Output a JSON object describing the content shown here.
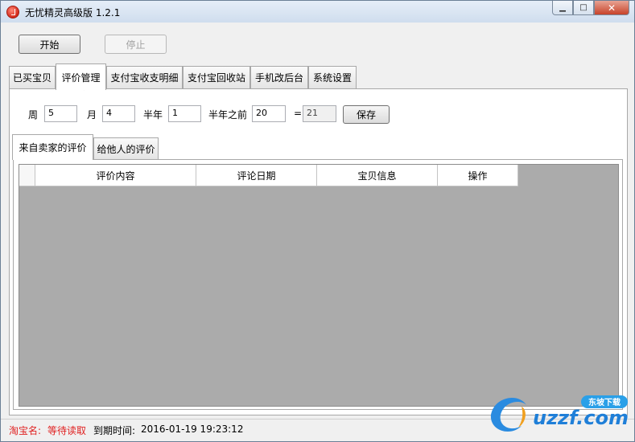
{
  "window": {
    "title": "无忧精灵高级版 1.2.1"
  },
  "window_controls": {
    "minimize": "▁",
    "maximize": "□",
    "close": "✕"
  },
  "toolbar": {
    "start_label": "开始",
    "stop_label": "停止"
  },
  "tabs": [
    {
      "label": "已买宝贝"
    },
    {
      "label": "评价管理"
    },
    {
      "label": "支付宝收支明细"
    },
    {
      "label": "支付宝回收站"
    },
    {
      "label": "手机改后台"
    },
    {
      "label": "系统设置"
    }
  ],
  "settings": {
    "week_label": "周",
    "week_value": "5",
    "month_label": "月",
    "month_value": "4",
    "halfyear_label": "半年",
    "halfyear_value": "1",
    "before_halfyear_label": "半年之前",
    "before_halfyear_value": "20",
    "equals_label": "=",
    "total_value": "21",
    "save_label": "保存"
  },
  "subtabs": [
    {
      "label": "来自卖家的评价"
    },
    {
      "label": "给他人的评价"
    }
  ],
  "table": {
    "columns": [
      "评价内容",
      "评论日期",
      "宝贝信息",
      "操作"
    ]
  },
  "status": {
    "shop_label": "淘宝名:",
    "shop_value": "等待读取",
    "expire_label": "到期时间:",
    "expire_value": "2016-01-19 19:23:12"
  },
  "watermark": {
    "text": "uzzf.com",
    "badge": "东坡下载"
  }
}
